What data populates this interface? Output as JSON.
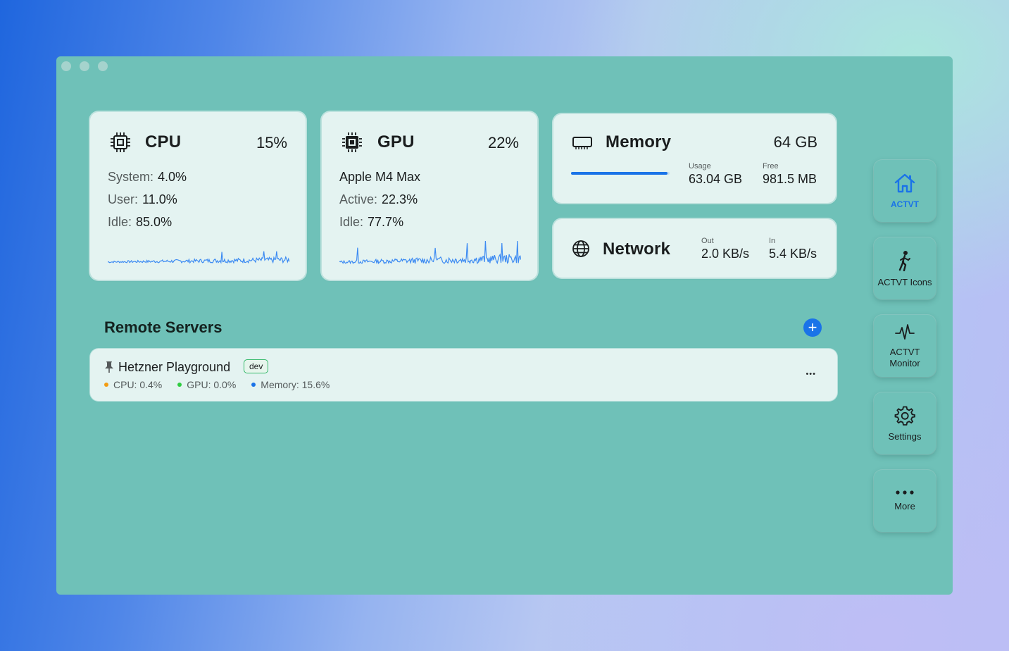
{
  "cpu": {
    "title": "CPU",
    "percent": "15%",
    "lines": [
      {
        "label": "System:",
        "value": "4.0%"
      },
      {
        "label": "User:",
        "value": "11.0%"
      },
      {
        "label": "Idle:",
        "value": "85.0%"
      }
    ]
  },
  "gpu": {
    "title": "GPU",
    "percent": "22%",
    "model": "Apple M4 Max",
    "lines": [
      {
        "label": "Active:",
        "value": "22.3%"
      },
      {
        "label": "Idle:",
        "value": "77.7%"
      }
    ]
  },
  "memory": {
    "title": "Memory",
    "total": "64 GB",
    "usage_label": "Usage",
    "usage_value": "63.04 GB",
    "free_label": "Free",
    "free_value": "981.5 MB",
    "usage_fraction": 0.98
  },
  "network": {
    "title": "Network",
    "out_label": "Out",
    "out_value": "2.0 KB/s",
    "in_label": "In",
    "in_value": "5.4 KB/s"
  },
  "remote": {
    "title": "Remote Servers",
    "add_label": "+",
    "servers": [
      {
        "name": "Hetzner Playground",
        "tag": "dev",
        "cpu": "CPU: 0.4%",
        "gpu": "GPU: 0.0%",
        "memory": "Memory: 15.6%",
        "menu": "•••"
      }
    ]
  },
  "sidebar": {
    "items": [
      {
        "label": "ACTVT",
        "icon": "house-icon",
        "active": true
      },
      {
        "label": "ACTVT Icons",
        "icon": "walking-figure-icon"
      },
      {
        "label": "ACTVT Monitor",
        "icon": "pulse-icon"
      },
      {
        "label": "Settings",
        "icon": "gear-icon"
      },
      {
        "label": "More",
        "icon": "ellipsis-icon"
      }
    ]
  },
  "colors": {
    "accent": "#1a73e8",
    "spark": "#3d8bf2",
    "cpu_dot": "#f39c12",
    "gpu_dot": "#2ecc40",
    "mem_dot": "#1a73e8",
    "tag_border": "#34b96a"
  }
}
